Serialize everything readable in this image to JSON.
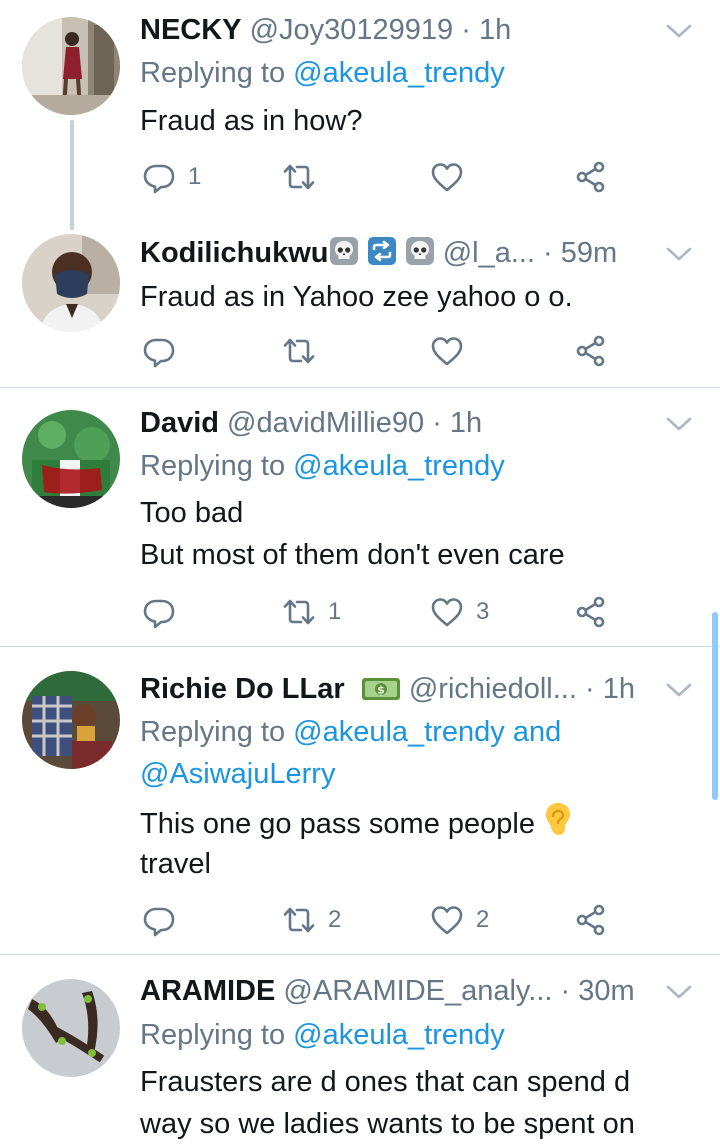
{
  "tweets": [
    {
      "name": "NECKY",
      "handle": "@Joy30129919",
      "time": "1h",
      "replying_prefix": "Replying to ",
      "replying_to": "@akeula_trendy",
      "text_lines": [
        "Fraud as in how?"
      ],
      "counts": {
        "reply": "1",
        "retweet": "",
        "like": ""
      }
    },
    {
      "name": "Kodilichukwu",
      "name_emojis": [
        "skull-emoji",
        "repeat-emoji",
        "skull-emoji"
      ],
      "handle": "@l_a...",
      "time": "59m",
      "text_lines": [
        "Fraud as in Yahoo zee yahoo o o."
      ],
      "counts": {
        "reply": "",
        "retweet": "",
        "like": ""
      }
    },
    {
      "name": "David",
      "handle": "@davidMillie90",
      "time": "1h",
      "replying_prefix": "Replying to ",
      "replying_to": "@akeula_trendy",
      "text_lines": [
        "Too bad",
        "But most of them don't even care"
      ],
      "counts": {
        "reply": "",
        "retweet": "1",
        "like": "3"
      }
    },
    {
      "name": "Richie Do LLar",
      "name_emojis": [
        "dollar-banknote-emoji"
      ],
      "handle": "@richiedoll...",
      "time": "1h",
      "replying_prefix": "Replying to ",
      "replying_to": "@akeula_trendy and",
      "replying_to_2": "@AsiwajuLerry",
      "text_lines": [
        "This one go pass some people",
        "travel"
      ],
      "counts": {
        "reply": "",
        "retweet": "2",
        "like": "2"
      }
    },
    {
      "name": "ARAMIDE",
      "handle": "@ARAMIDE_analy...",
      "time": "30m",
      "replying_prefix": "Replying to ",
      "replying_to": "@akeula_trendy",
      "text_lines": [
        "Frausters are d ones that can spend d",
        "way so we ladies wants to be spent on"
      ]
    }
  ],
  "separator": " · ",
  "colors": {
    "text": "#14171a",
    "secondary": "#657786",
    "link": "#1b95e0",
    "divider": "#cfd6dc"
  },
  "icons": [
    "reply-icon",
    "retweet-icon",
    "like-icon",
    "share-icon",
    "chevron-down-icon"
  ]
}
